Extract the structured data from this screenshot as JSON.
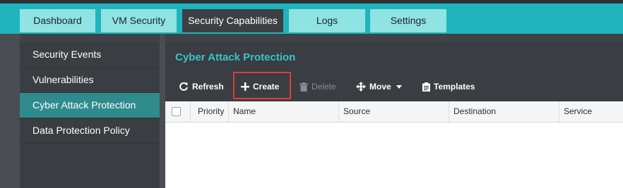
{
  "nav": {
    "tabs": [
      {
        "label": "Dashboard"
      },
      {
        "label": "VM Security"
      },
      {
        "label": "Security Capabilities"
      },
      {
        "label": "Logs"
      },
      {
        "label": "Settings"
      }
    ],
    "active_tab": "Security Capabilities"
  },
  "sidebar": {
    "items": [
      {
        "label": "Security Events"
      },
      {
        "label": "Vulnerabilities"
      },
      {
        "label": "Cyber Attack Protection"
      },
      {
        "label": "Data Protection Policy"
      }
    ],
    "active_item": "Cyber Attack Protection"
  },
  "main": {
    "title": "Cyber Attack Protection",
    "toolbar": {
      "refresh_label": "Refresh",
      "create_label": "Create",
      "delete_label": "Delete",
      "move_label": "Move",
      "templates_label": "Templates"
    },
    "table": {
      "columns": [
        "Priority",
        "Name",
        "Source",
        "Destination",
        "Service"
      ],
      "rows": []
    }
  },
  "colors": {
    "topbar": "#1fb4bd",
    "tab": "#8fe3e3",
    "tab_active": "#3c4044",
    "sidebar_active": "#2f8b8c",
    "title": "#38c4cc",
    "highlight_box": "#e03c3c"
  },
  "icons": {
    "refresh": "refresh-icon",
    "create": "plus-icon",
    "delete": "trash-icon",
    "move": "move-arrows-icon",
    "move_dropdown": "caret-down-icon",
    "templates": "clipboard-icon"
  }
}
